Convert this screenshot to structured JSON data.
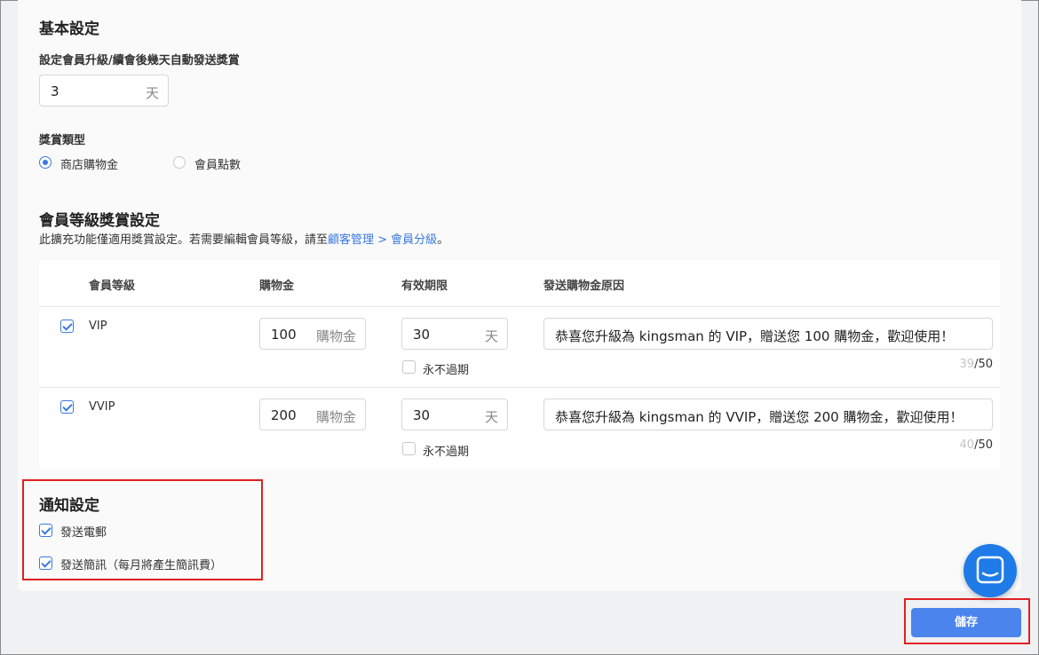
{
  "basic": {
    "title": "基本設定",
    "days_label": "設定會員升級/續會後幾天自動發送獎賞",
    "days_value": "3",
    "days_unit": "天",
    "reward_type_label": "獎賞類型",
    "reward_options": [
      {
        "label": "商店購物金",
        "selected": true
      },
      {
        "label": "會員點數",
        "selected": false
      }
    ]
  },
  "tier": {
    "title": "會員等級獎賞設定",
    "desc_prefix": "此擴充功能僅適用獎賞設定。若需要編輯會員等級，請至",
    "desc_link": "顧客管理 > 會員分級",
    "desc_suffix": "。",
    "columns": [
      "會員等級",
      "購物金",
      "有效期限",
      "發送購物金原因"
    ],
    "rows": [
      {
        "checked": true,
        "level": "VIP",
        "credit": "100",
        "credit_unit": "購物金",
        "days": "30",
        "days_unit": "天",
        "never_expire_label": "永不過期",
        "never_expire": false,
        "reason": "恭喜您升級為 kingsman 的 VIP，贈送您 100 購物金，歡迎使用！",
        "count": "39",
        "max": "/50"
      },
      {
        "checked": true,
        "level": "VVIP",
        "credit": "200",
        "credit_unit": "購物金",
        "days": "30",
        "days_unit": "天",
        "never_expire_label": "永不過期",
        "never_expire": false,
        "reason": "恭喜您升級為 kingsman 的 VVIP，贈送您 200 購物金，歡迎使用！",
        "count": "40",
        "max": "/50"
      }
    ]
  },
  "notify": {
    "title": "通知設定",
    "options": [
      {
        "label": "發送電郵",
        "checked": true
      },
      {
        "label": "發送簡訊（每月將產生簡訊費）",
        "checked": true
      }
    ]
  },
  "actions": {
    "save_label": "儲存"
  },
  "chat": {
    "icon": "chat-bubble-icon",
    "color": "#1f7be8"
  }
}
